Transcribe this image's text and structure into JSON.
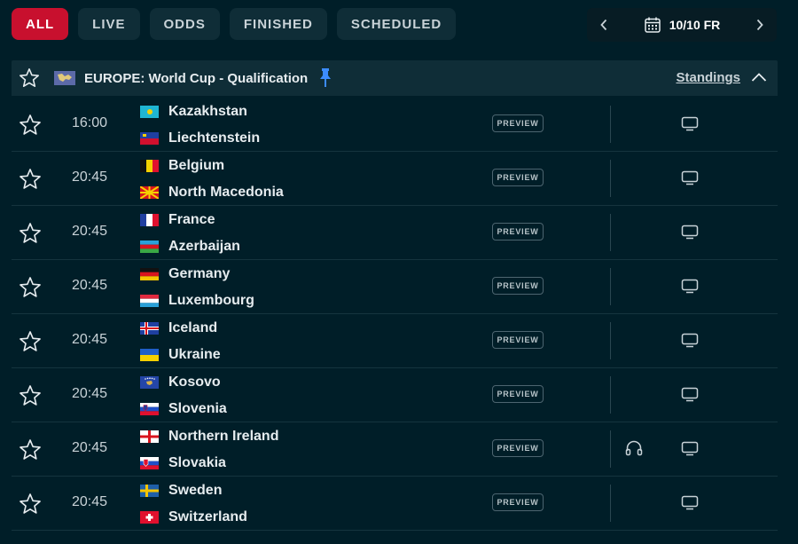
{
  "filters": [
    {
      "label": "ALL",
      "active": true
    },
    {
      "label": "LIVE",
      "active": false
    },
    {
      "label": "ODDS",
      "active": false
    },
    {
      "label": "FINISHED",
      "active": false
    },
    {
      "label": "SCHEDULED",
      "active": false
    }
  ],
  "date_picker": {
    "prev_icon": "chevron-left-icon",
    "calendar_icon": "calendar-icon",
    "label": "10/10 FR",
    "next_icon": "chevron-right-icon"
  },
  "league": {
    "title": "EUROPE: World Cup - Qualification",
    "flag_icon": "europe-flag-icon",
    "pin_icon": "pin-icon",
    "standings_label": "Standings",
    "collapse_icon": "chevron-up-icon"
  },
  "colors": {
    "background": "#001e28",
    "panel": "#0f2d37",
    "accent": "#c8102e",
    "pin": "#3c8cff"
  },
  "matches": [
    {
      "time": "16:00",
      "home": "Kazakhstan",
      "away": "Liechtenstein",
      "preview": "PREVIEW",
      "audio": false
    },
    {
      "time": "20:45",
      "home": "Belgium",
      "away": "North Macedonia",
      "preview": "PREVIEW",
      "audio": false
    },
    {
      "time": "20:45",
      "home": "France",
      "away": "Azerbaijan",
      "preview": "PREVIEW",
      "audio": false
    },
    {
      "time": "20:45",
      "home": "Germany",
      "away": "Luxembourg",
      "preview": "PREVIEW",
      "audio": false
    },
    {
      "time": "20:45",
      "home": "Iceland",
      "away": "Ukraine",
      "preview": "PREVIEW",
      "audio": false
    },
    {
      "time": "20:45",
      "home": "Kosovo",
      "away": "Slovenia",
      "preview": "PREVIEW",
      "audio": false
    },
    {
      "time": "20:45",
      "home": "Northern Ireland",
      "away": "Slovakia",
      "preview": "PREVIEW",
      "audio": true
    },
    {
      "time": "20:45",
      "home": "Sweden",
      "away": "Switzerland",
      "preview": "PREVIEW",
      "audio": false
    }
  ]
}
